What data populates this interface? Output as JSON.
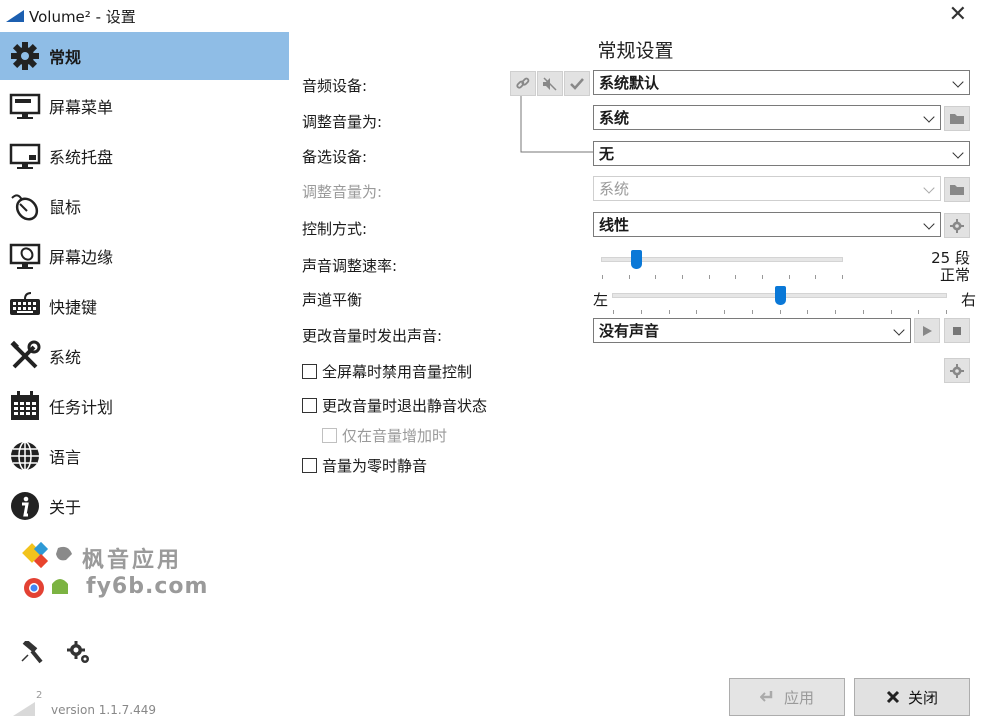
{
  "window": {
    "title": "Volume² - 设置",
    "close_glyph": "✕"
  },
  "sidebar": {
    "items": [
      {
        "label": "常规",
        "icon": "gear-icon",
        "active": true
      },
      {
        "label": "屏幕菜单",
        "icon": "screen-menu-icon"
      },
      {
        "label": "系统托盘",
        "icon": "system-tray-icon"
      },
      {
        "label": "鼠标",
        "icon": "mouse-icon"
      },
      {
        "label": "屏幕边缘",
        "icon": "screen-edge-icon"
      },
      {
        "label": "快捷键",
        "icon": "keyboard-icon"
      },
      {
        "label": "系统",
        "icon": "tools-icon"
      },
      {
        "label": "任务计划",
        "icon": "calendar-icon"
      },
      {
        "label": "语言",
        "icon": "globe-icon"
      },
      {
        "label": "关于",
        "icon": "info-icon"
      }
    ],
    "watermark": {
      "line1": "枫音应用",
      "line2": "fy6b.com"
    },
    "version": "version 1.1.7.449",
    "version_badge": "2"
  },
  "main": {
    "title": "常规设置",
    "audio_device": {
      "label": "音频设备:",
      "value": "系统默认"
    },
    "adjust_volume_1": {
      "label": "调整音量为:",
      "value": "系统"
    },
    "backup_device": {
      "label": "备选设备:",
      "value": "无"
    },
    "adjust_volume_2": {
      "label": "调整音量为:",
      "value": "系统"
    },
    "control_mode": {
      "label": "控制方式:",
      "value": "线性"
    },
    "speed": {
      "label": "声音调整速率:",
      "value_text": "25 段",
      "sub_text": "正常",
      "steps": 25,
      "position_fraction": 0.14
    },
    "balance": {
      "label": "声道平衡",
      "left": "左",
      "right": "右",
      "position_fraction": 0.5
    },
    "change_sound": {
      "label": "更改音量时发出声音:",
      "value": "没有声音"
    },
    "checkboxes": {
      "fullscreen_disable": "全屏幕时禁用音量控制",
      "exit_mute": "更改音量时退出静音状态",
      "only_increase": "仅在音量增加时",
      "mute_zero": "音量为零时静音"
    }
  },
  "footer": {
    "apply_label": "应用",
    "close_label": "关闭"
  },
  "colors": {
    "accent": "#0a78d7",
    "sidebar_active": "#8fbde6"
  }
}
